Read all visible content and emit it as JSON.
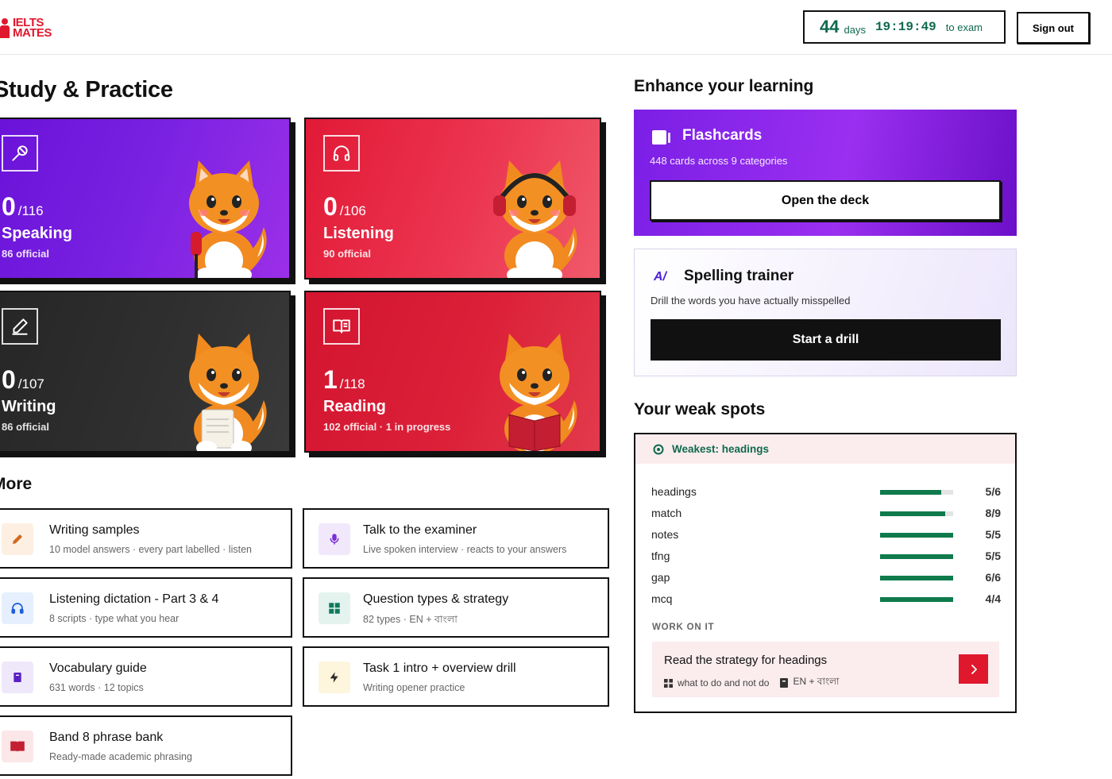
{
  "header": {
    "logo": "IELTS MATES",
    "logo_line1": "IELTS",
    "logo_line2": "MATES",
    "countdown_days": "44",
    "countdown_days_label": "days",
    "countdown_time": "19:19:49",
    "countdown_suffix": "to exam",
    "sign_out": "Sign out"
  },
  "study": {
    "title": "Study & Practice",
    "cards": [
      {
        "done": "0",
        "total": "/116",
        "name": "Speaking",
        "sub": "86 official",
        "icon": "microphone-icon"
      },
      {
        "done": "0",
        "total": "/106",
        "name": "Listening",
        "sub": "90 official",
        "icon": "headphones-icon"
      },
      {
        "done": "0",
        "total": "/107",
        "name": "Writing",
        "sub": "86 official",
        "icon": "pencil-icon"
      },
      {
        "done": "1",
        "total": "/118",
        "name": "Reading",
        "sub": "102 official · 1 in progress",
        "icon": "book-icon"
      }
    ]
  },
  "more": {
    "title": "More",
    "items": [
      {
        "title": "Writing samples",
        "sub": "10 model answers · every part labelled · listen",
        "icon": "pencil-icon",
        "icon_bg": "#fdf0e2",
        "icon_color": "#d2691e"
      },
      {
        "title": "Talk to the examiner",
        "sub": "Live spoken interview · reacts to your answers",
        "icon": "microphone-icon",
        "icon_bg": "#f1e8fb",
        "icon_color": "#7b2fd6"
      },
      {
        "title": "Listening dictation - Part 3 & 4",
        "sub": "8 scripts · type what you hear",
        "icon": "headphones-icon",
        "icon_bg": "#e6effd",
        "icon_color": "#1d5fd6"
      },
      {
        "title": "Question types & strategy",
        "sub": "82 types · EN + বাংলা",
        "icon": "grid-icon",
        "icon_bg": "#e4f3ee",
        "icon_color": "#0f7a5c"
      },
      {
        "title": "Vocabulary guide",
        "sub": "631 words · 12 topics",
        "icon": "book-icon",
        "icon_bg": "#efe8fb",
        "icon_color": "#5b1fc6"
      },
      {
        "title": "Task 1 intro + overview drill",
        "sub": "Writing opener practice",
        "icon": "lightning-icon",
        "icon_bg": "#fdf5dc",
        "icon_color": "#2a2a2a"
      },
      {
        "title": "Band 8 phrase bank",
        "sub": "Ready-made academic phrasing",
        "icon": "open-book-icon",
        "icon_bg": "#fbe6e8",
        "icon_color": "#c41e32"
      }
    ]
  },
  "enhance": {
    "title": "Enhance your learning",
    "flashcards": {
      "title": "Flashcards",
      "sub": "448 cards across 9 categories",
      "button": "Open the deck"
    },
    "spelling": {
      "title": "Spelling trainer",
      "sub": "Drill the words you have actually misspelled",
      "button": "Start a drill"
    }
  },
  "weak": {
    "title": "Your weak spots",
    "weakest": "Weakest: headings",
    "rows": [
      {
        "label": "headings",
        "score": "5/6",
        "fraction": 0.833
      },
      {
        "label": "match",
        "score": "8/9",
        "fraction": 0.889
      },
      {
        "label": "notes",
        "score": "5/5",
        "fraction": 1.0
      },
      {
        "label": "tfng",
        "score": "5/5",
        "fraction": 1.0
      },
      {
        "label": "gap",
        "score": "6/6",
        "fraction": 1.0
      },
      {
        "label": "mcq",
        "score": "4/4",
        "fraction": 1.0
      }
    ],
    "work_on_it": "WORK ON IT",
    "strategy": {
      "title": "Read the strategy for headings",
      "meta1": "what to do and not do",
      "meta2": "EN + বাংলা"
    }
  },
  "colors": {
    "brand_red": "#e0182d",
    "accent_green": "#0f6a4f"
  }
}
